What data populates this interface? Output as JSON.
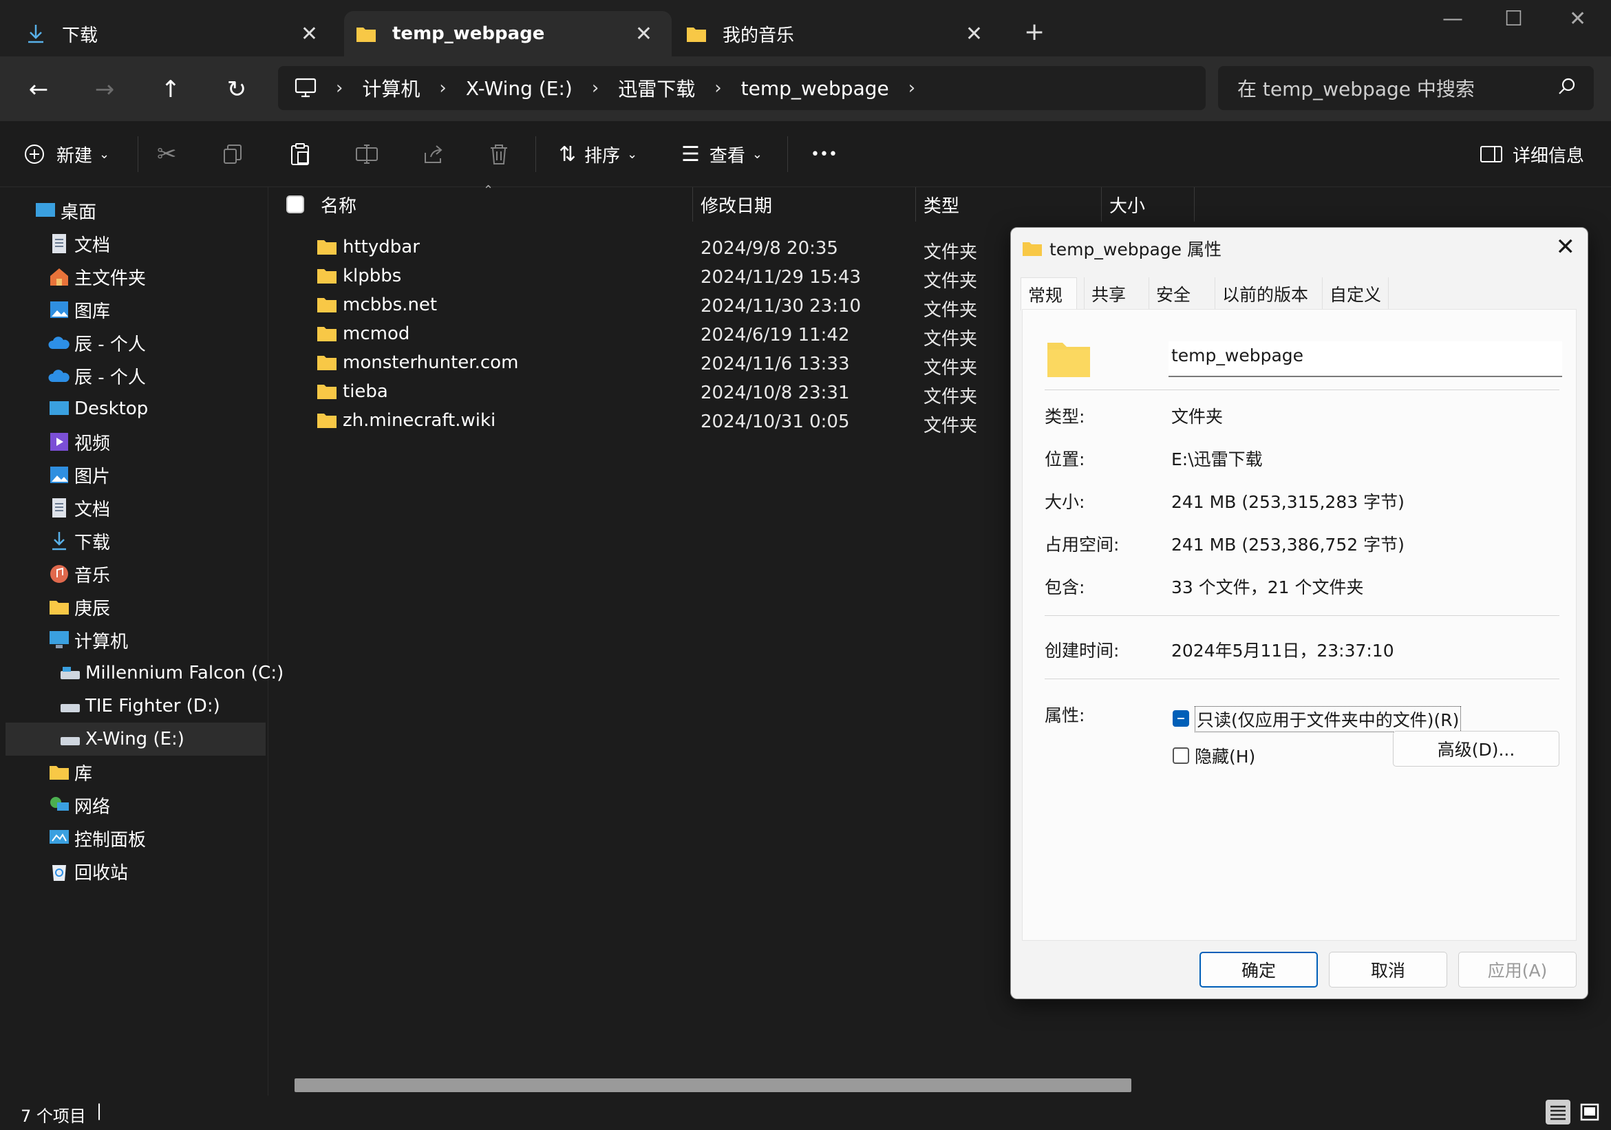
{
  "tabs": [
    {
      "label": "下载",
      "icon": "download-icon"
    },
    {
      "label": "temp_webpage",
      "icon": "folder-icon",
      "active": true
    },
    {
      "label": "我的音乐",
      "icon": "folder-icon"
    }
  ],
  "new_tab_symbol": "+",
  "close_symbol": "✕",
  "breadcrumb": [
    "计算机",
    "X-Wing (E:)",
    "迅雷下载",
    "temp_webpage"
  ],
  "search_placeholder": "在 temp_webpage 中搜索",
  "toolbar": {
    "new_label": "新建",
    "sort_label": "排序",
    "view_label": "查看",
    "more_label": "•••",
    "details_label": "详细信息"
  },
  "sidebar": [
    {
      "label": "桌面",
      "icon": "desktop-icon"
    },
    {
      "label": "文档",
      "icon": "document-icon"
    },
    {
      "label": "主文件夹",
      "icon": "home-icon"
    },
    {
      "label": "图库",
      "icon": "gallery-icon"
    },
    {
      "label": "辰 - 个人",
      "icon": "onedrive-icon"
    },
    {
      "label": "辰 - 个人",
      "icon": "onedrive-icon"
    },
    {
      "label": "Desktop",
      "icon": "desktop-icon"
    },
    {
      "label": "视频",
      "icon": "video-icon"
    },
    {
      "label": "图片",
      "icon": "picture-icon"
    },
    {
      "label": "文档",
      "icon": "document-icon"
    },
    {
      "label": "下载",
      "icon": "download-icon"
    },
    {
      "label": "音乐",
      "icon": "music-icon"
    },
    {
      "label": "庚辰",
      "icon": "folder-icon"
    },
    {
      "label": "计算机",
      "icon": "computer-icon"
    },
    {
      "label": "Millennium Falcon (C:)",
      "icon": "drive-icon"
    },
    {
      "label": "TIE Fighter (D:)",
      "icon": "drive-icon"
    },
    {
      "label": "X-Wing (E:)",
      "icon": "drive-icon"
    },
    {
      "label": "库",
      "icon": "folder-icon"
    },
    {
      "label": "网络",
      "icon": "network-icon"
    },
    {
      "label": "控制面板",
      "icon": "control-panel-icon"
    },
    {
      "label": "回收站",
      "icon": "recycle-bin-icon"
    }
  ],
  "columns": {
    "name": "名称",
    "modified": "修改日期",
    "type": "类型",
    "size": "大小"
  },
  "files": [
    {
      "name": "httydbar",
      "modified": "2024/9/8 20:35",
      "type": "文件夹"
    },
    {
      "name": "klpbbs",
      "modified": "2024/11/29 15:43",
      "type": "文件夹"
    },
    {
      "name": "mcbbs.net",
      "modified": "2024/11/30 23:10",
      "type": "文件夹"
    },
    {
      "name": "mcmod",
      "modified": "2024/6/19 11:42",
      "type": "文件夹"
    },
    {
      "name": "monsterhunter.com",
      "modified": "2024/11/6 13:33",
      "type": "文件夹"
    },
    {
      "name": "tieba",
      "modified": "2024/10/8 23:31",
      "type": "文件夹"
    },
    {
      "name": "zh.minecraft.wiki",
      "modified": "2024/10/31 0:05",
      "type": "文件夹"
    }
  ],
  "status": {
    "count": "7 个项目",
    "cursor": "|"
  },
  "dialog": {
    "title": "temp_webpage 属性",
    "tabs": [
      "常规",
      "共享",
      "安全",
      "以前的版本",
      "自定义"
    ],
    "name_value": "temp_webpage",
    "rows": [
      {
        "label": "类型:",
        "value": "文件夹"
      },
      {
        "label": "位置:",
        "value": "E:\\迅雷下载"
      },
      {
        "label": "大小:",
        "value": "241 MB (253,315,283 字节)"
      },
      {
        "label": "占用空间:",
        "value": "241 MB (253,386,752 字节)"
      },
      {
        "label": "包含:",
        "value": "33 个文件，21 个文件夹"
      }
    ],
    "created_label": "创建时间:",
    "created_value": "2024年5月11日，23:37:10",
    "attr_label": "属性:",
    "readonly_label": "只读(仅应用于文件夹中的文件)(R)",
    "hidden_label": "隐藏(H)",
    "advanced_label": "高级(D)...",
    "ok_label": "确定",
    "cancel_label": "取消",
    "apply_label": "应用(A)"
  },
  "colors": {
    "folder": "#f8c846",
    "accent": "#005fb8",
    "dark_bg": "#1c1c1c"
  }
}
